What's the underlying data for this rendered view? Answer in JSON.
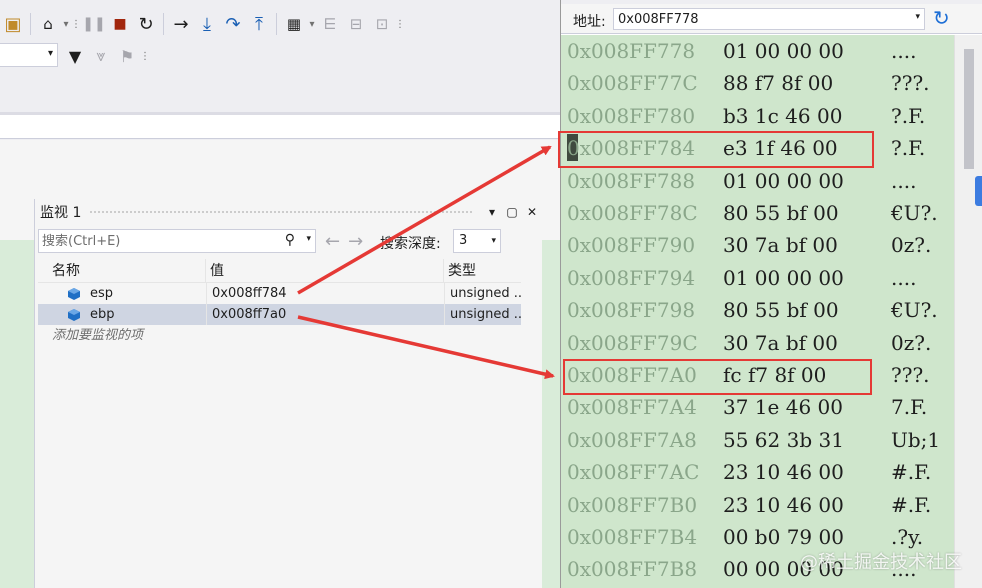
{
  "toolbar": {
    "row1_icons": [
      "search-folder-icon",
      "home-icon",
      "pause-icon",
      "stop-icon",
      "restart-icon",
      "show-next-statement-icon",
      "step-into-icon",
      "step-over-icon",
      "step-out-icon",
      "hex-display-icon",
      "threads-icon"
    ],
    "row2_icons": [
      "filter-icon",
      "filter-disabled-icon",
      "flag-icon"
    ]
  },
  "watch": {
    "title": "监视 1",
    "window_buttons": [
      "▾",
      "▢",
      "✕"
    ],
    "search_placeholder": "搜索(Ctrl+E)",
    "depth_label": "搜索深度:",
    "depth_value": "3",
    "columns": [
      "名称",
      "值",
      "类型"
    ],
    "rows": [
      {
        "name": "esp",
        "value": "0x008ff784",
        "type": "unsigned ..."
      },
      {
        "name": "ebp",
        "value": "0x008ff7a0",
        "type": "unsigned ..."
      }
    ],
    "add_watch_text": "添加要监视的项"
  },
  "memory": {
    "address_label": "地址:",
    "address_value": "0x008FF778",
    "rows": [
      {
        "addr": "0x008FF778",
        "bytes": "01 00 00 00",
        "ascii": "...."
      },
      {
        "addr": "0x008FF77C",
        "bytes": "88 f7 8f 00",
        "ascii": "???."
      },
      {
        "addr": "0x008FF780",
        "bytes": "b3 1c 46 00",
        "ascii": "?.F."
      },
      {
        "addr": "0x008FF784",
        "bytes": "e3 1f 46 00",
        "ascii": "?.F."
      },
      {
        "addr": "0x008FF788",
        "bytes": "01 00 00 00",
        "ascii": "...."
      },
      {
        "addr": "0x008FF78C",
        "bytes": "80 55 bf 00",
        "ascii": "€U?."
      },
      {
        "addr": "0x008FF790",
        "bytes": "30 7a bf 00",
        "ascii": "0z?."
      },
      {
        "addr": "0x008FF794",
        "bytes": "01 00 00 00",
        "ascii": "...."
      },
      {
        "addr": "0x008FF798",
        "bytes": "80 55 bf 00",
        "ascii": "€U?."
      },
      {
        "addr": "0x008FF79C",
        "bytes": "30 7a bf 00",
        "ascii": "0z?."
      },
      {
        "addr": "0x008FF7A0",
        "bytes": "fc f7 8f 00",
        "ascii": "???."
      },
      {
        "addr": "0x008FF7A4",
        "bytes": "37 1e 46 00",
        "ascii": "7.F."
      },
      {
        "addr": "0x008FF7A8",
        "bytes": "55 62 3b 31",
        "ascii": "Ub;1"
      },
      {
        "addr": "0x008FF7AC",
        "bytes": "23 10 46 00",
        "ascii": "#.F."
      },
      {
        "addr": "0x008FF7B0",
        "bytes": "23 10 46 00",
        "ascii": "#.F."
      },
      {
        "addr": "0x008FF7B4",
        "bytes": "00 b0 79 00",
        "ascii": ".?y."
      },
      {
        "addr": "0x008FF7B8",
        "bytes": "00 00 00 00",
        "ascii": "...."
      }
    ]
  },
  "watermark": "@稀土掘金技术社区",
  "colors": {
    "annotation_red": "#e53935",
    "memory_bg": "#cfe6cc",
    "address_text": "#8aa68a"
  }
}
